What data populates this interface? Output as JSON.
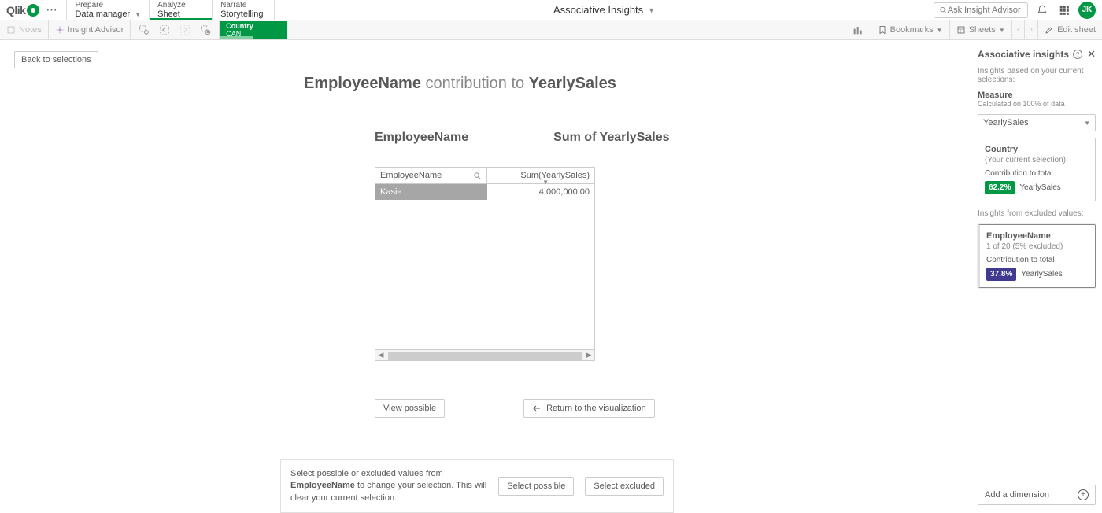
{
  "topbar": {
    "logo_text": "Qlik",
    "nav": [
      {
        "top": "Prepare",
        "sub": "Data manager",
        "has_dd": true
      },
      {
        "top": "Analyze",
        "sub": "Sheet"
      },
      {
        "top": "Narrate",
        "sub": "Storytelling"
      }
    ],
    "app_title": "Associative Insights",
    "search_placeholder": "Ask Insight Advisor",
    "avatar": "JK"
  },
  "toolbar": {
    "notes": "Notes",
    "insight": "Insight Advisor",
    "chip_title": "Country",
    "chip_value": "CAN",
    "bookmarks": "Bookmarks",
    "sheets": "Sheets",
    "edit": "Edit sheet"
  },
  "content": {
    "back": "Back to selections",
    "headline_a": "EmployeeName",
    "headline_b": " contribution to ",
    "headline_c": "YearlySales",
    "col1": "EmployeeName",
    "col2": "Sum of YearlySales",
    "th1": "EmployeeName",
    "th2": "Sum(YearlySales)",
    "row_name": "Kasie",
    "row_val": "4,000,000.00",
    "view_possible": "View possible",
    "return_viz": "Return to the visualization",
    "hint_a": "Select possible or excluded values from ",
    "hint_b": "EmployeeName",
    "hint_c": " to change your selection. This will clear your current selection.",
    "sel_possible": "Select possible",
    "sel_excluded": "Select excluded"
  },
  "panel": {
    "title": "Associative insights",
    "subtitle": "Insights based on your current selections:",
    "measure_label": "Measure",
    "measure_sub": "Calculated on 100% of data",
    "measure_value": "YearlySales",
    "card1_title": "Country",
    "card1_sub": "(Your current selection)",
    "contrib": "Contribution to total",
    "card1_pct": "62.2%",
    "card1_val": "YearlySales",
    "excluded_label": "Insights from excluded values:",
    "card2_title": "EmployeeName",
    "card2_sub": "1 of 20 (5% excluded)",
    "card2_pct": "37.8%",
    "card2_val": "YearlySales",
    "add_dim": "Add a dimension"
  },
  "chart_data": {
    "type": "table",
    "columns": [
      "EmployeeName",
      "Sum(YearlySales)"
    ],
    "rows": [
      [
        "Kasie",
        4000000.0
      ]
    ]
  }
}
